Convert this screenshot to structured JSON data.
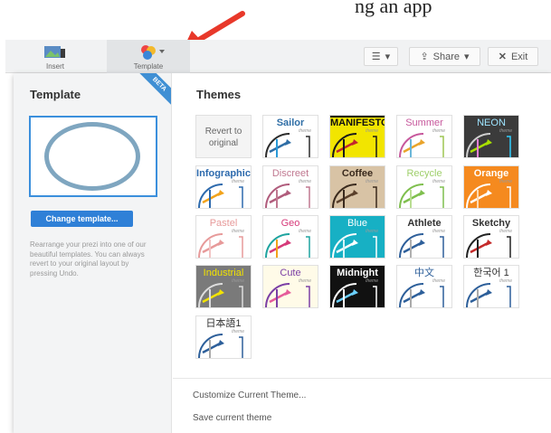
{
  "page_fragment": "ng an app",
  "toolbar": {
    "insert_label": "Insert",
    "template_label": "Template",
    "menu_caret": "▾",
    "share_label": "Share",
    "exit_label": "Exit"
  },
  "left_panel": {
    "badge": "BETA",
    "title": "Template",
    "change_button": "Change template...",
    "description": "Rearrange your prezi into one of our beautiful templates. You can always revert to your original layout by pressing Undo."
  },
  "themes": {
    "title": "Themes",
    "revert_line1": "Revert to",
    "revert_line2": "original",
    "subtitle_word": "theme",
    "tiles": [
      {
        "name": "Sailor",
        "bg": "#ffffff",
        "name_color": "#2f6ea6",
        "stroke": "#2c2c2c",
        "accents": [
          "#2f6ea6",
          "#2a9ad8",
          "#2c2c2c"
        ],
        "bold": true
      },
      {
        "name": "MANIFESTO",
        "bg": "#f2e500",
        "name_color": "#111111",
        "stroke": "#1a1a1a",
        "accents": [
          "#c2272d",
          "#1a1a1a",
          "#1a1a1a"
        ],
        "bold": true,
        "band": "#111111"
      },
      {
        "name": "Summer",
        "bg": "#ffffff",
        "name_color": "#c7589c",
        "stroke": "#c7589c",
        "accents": [
          "#e9a42b",
          "#6bb7d9",
          "#9ec652"
        ],
        "bold": false
      },
      {
        "name": "NEON",
        "bg": "#3b3b3b",
        "name_color": "#9ee4ff",
        "stroke": "#cfcfcf",
        "accents": [
          "#a8e000",
          "#e77fd4",
          "#30d0ff"
        ],
        "bold": false
      },
      {
        "name": "Infographic",
        "bg": "#ffffff",
        "name_color": "#2d6aad",
        "stroke": "#2d6aad",
        "accents": [
          "#f2a31b",
          "#2d6aad",
          "#2d6aad"
        ],
        "bold": true
      },
      {
        "name": "Discreet",
        "bg": "#ffffff",
        "name_color": "#c07890",
        "stroke": "#b05c7c",
        "accents": [
          "#b05c7c",
          "#c07890",
          "#c07890"
        ],
        "bold": false
      },
      {
        "name": "Coffee",
        "bg": "#d8c3a5",
        "name_color": "#3a2a1d",
        "stroke": "#3a2a1d",
        "accents": [
          "#5a3f2a",
          "#3a2a1d",
          "#3a2a1d"
        ],
        "bold": true
      },
      {
        "name": "Recycle",
        "bg": "#ffffff",
        "name_color": "#9fcf6b",
        "stroke": "#7fbf4e",
        "accents": [
          "#7fbf4e",
          "#b9dd92",
          "#7fbf4e"
        ],
        "bold": false
      },
      {
        "name": "Orange",
        "bg": "#f58a1f",
        "name_color": "#ffffff",
        "stroke": "#ffffff",
        "accents": [
          "#ffffff",
          "#ffd9b0",
          "#ffffff"
        ],
        "bold": true
      },
      {
        "name": "Pastel",
        "bg": "#ffffff",
        "name_color": "#e79a9a",
        "stroke": "#e79a9a",
        "accents": [
          "#e79a9a",
          "#f2c4c4",
          "#e79a9a"
        ],
        "bold": false
      },
      {
        "name": "Geo",
        "bg": "#ffffff",
        "name_color": "#d63a7a",
        "stroke": "#1fa4a0",
        "accents": [
          "#d63a7a",
          "#f2a31b",
          "#1fa4a0"
        ],
        "bold": false
      },
      {
        "name": "Blue",
        "bg": "#17b0c4",
        "name_color": "#ffffff",
        "stroke": "#ffffff",
        "accents": [
          "#ffffff",
          "#d5f4f8",
          "#ffffff"
        ],
        "bold": false
      },
      {
        "name": "Athlete",
        "bg": "#ffffff",
        "name_color": "#333333",
        "stroke": "#2e5f9a",
        "accents": [
          "#2e5f9a",
          "#b0b0b0",
          "#2e5f9a"
        ],
        "bold": true
      },
      {
        "name": "Sketchy",
        "bg": "#ffffff",
        "name_color": "#333333",
        "stroke": "#222222",
        "accents": [
          "#c42a2a",
          "#222222",
          "#222222"
        ],
        "bold": true
      },
      {
        "name": "Industrial",
        "bg": "#7a7a7a",
        "name_color": "#f2e300",
        "stroke": "#dddddd",
        "accents": [
          "#f2e300",
          "#dddddd",
          "#dddddd"
        ],
        "bold": false
      },
      {
        "name": "Cute",
        "bg": "#fffbe8",
        "name_color": "#7b3fa5",
        "stroke": "#7b3fa5",
        "accents": [
          "#e65c9a",
          "#7b3fa5",
          "#7b3fa5"
        ],
        "bold": false
      },
      {
        "name": "Midnight",
        "bg": "#111111",
        "name_color": "#ffffff",
        "stroke": "#ffffff",
        "accents": [
          "#6bd0ff",
          "#ffffff",
          "#ffffff"
        ],
        "bold": true
      },
      {
        "name": "中文",
        "bg": "#ffffff",
        "name_color": "#2d5f9a",
        "stroke": "#2d5f9a",
        "accents": [
          "#2d5f9a",
          "#aaaaaa",
          "#2d5f9a"
        ],
        "bold": false
      },
      {
        "name": "한국어 1",
        "bg": "#ffffff",
        "name_color": "#333333",
        "stroke": "#2d5f9a",
        "accents": [
          "#2d5f9a",
          "#aaaaaa",
          "#2d5f9a"
        ],
        "bold": false
      },
      {
        "name": "日本語1",
        "bg": "#ffffff",
        "name_color": "#333333",
        "stroke": "#2d5f9a",
        "accents": [
          "#2d5f9a",
          "#aaaaaa",
          "#2d5f9a"
        ],
        "bold": false
      }
    ]
  },
  "bottom_links": {
    "customize": "Customize Current Theme...",
    "save": "Save current theme"
  },
  "colors": {
    "accent_blue": "#2f80d7",
    "callout_arrow": "#e8382a"
  }
}
